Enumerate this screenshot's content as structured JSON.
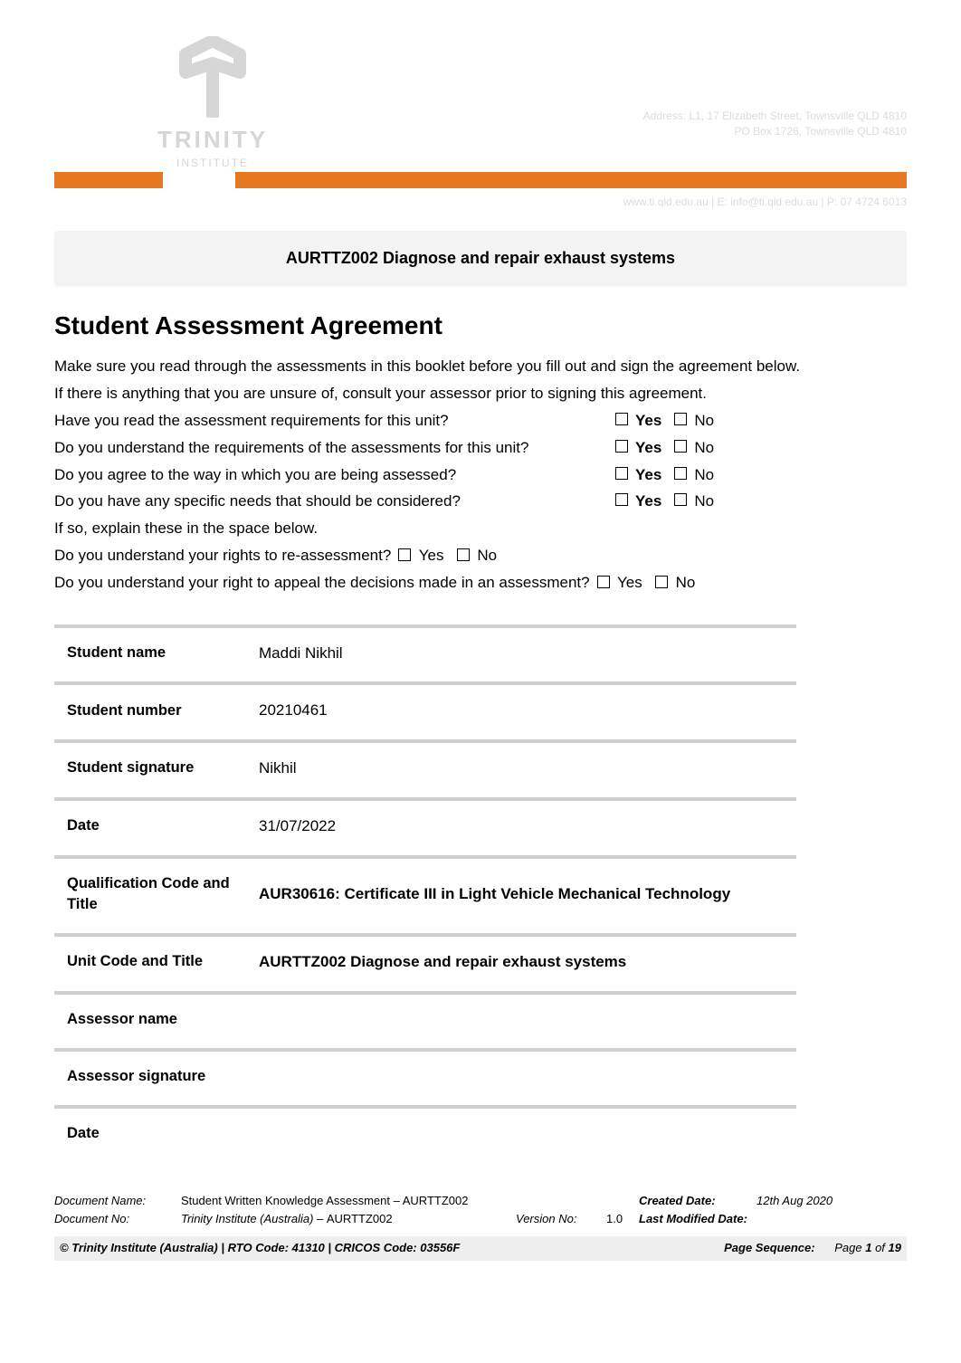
{
  "header": {
    "logo_text": "TRINITY",
    "logo_sub": "INSTITUTE",
    "addr_line1": "Address: L1, 17 Elizabeth Street, Townsville QLD 4810",
    "addr_line2": "PO Box 1726, Townsville QLD 4810",
    "addr_web": "www.ti.qld.edu.au | E: info@ti.qld.edu.au | P: 07 4724 6013"
  },
  "unit_band": "AURTTZ002 Diagnose and repair exhaust systems",
  "section_title": "Student Assessment Agreement",
  "intro_p1": "Make sure you read through the assessments in this booklet before you fill out and sign the agreement below.",
  "intro_p2": "If there is anything that you are unsure of, consult your assessor prior to signing this agreement.",
  "questions": {
    "q1": "Have you read the assessment requirements for this unit?",
    "q2": "Do you understand the requirements of the assessments for this unit?",
    "q3": "Do you agree to the way in which you are being assessed?",
    "q4": "Do you have any specific needs that should be considered?",
    "q5": "If so, explain these in the space below.",
    "q6": "Do you understand your rights to re-assessment?",
    "q7": "Do you understand your right to appeal the decisions made in an assessment?",
    "yes": "Yes",
    "no": "No"
  },
  "table": {
    "rows": [
      {
        "label": "Student name",
        "value": " Maddi Nikhil"
      },
      {
        "label": "Student number",
        "value": "20210461"
      },
      {
        "label": "Student signature",
        "value": "Nikhil"
      },
      {
        "label": "Date",
        "value": "31/07/2022"
      },
      {
        "label": "Qualification Code and Title",
        "value": "AUR30616: Certificate III in Light Vehicle Mechanical Technology",
        "strong": true
      },
      {
        "label": "Unit Code and Title",
        "value": "AURTTZ002 Diagnose and repair exhaust systems",
        "strong": true
      },
      {
        "label": "Assessor name",
        "value": ""
      },
      {
        "label": "Assessor signature",
        "value": ""
      },
      {
        "label": "Date",
        "value": ""
      }
    ]
  },
  "footer": {
    "docname_label": "Document Name:",
    "docname_value": "Student Written Knowledge Assessment – AURTTZ002",
    "created_label": "Created Date:",
    "created_value": "12th Aug 2020",
    "docno_label": "Document No:",
    "docno_value_prefix": "Trinity Institute (Australia) – ",
    "docno_value_code": "AURTTZ002",
    "version_label": "Version No:",
    "version_value": "1.0",
    "lastmod_label": "Last Modified Date:",
    "lastmod_value": "",
    "copyright": "© Trinity Institute (Australia) | RTO Code: 41310 | CRICOS Code: 03556F",
    "pageseq_label": "Page Sequence:",
    "page_prefix": "Page ",
    "page_num": "1",
    "page_of": " of ",
    "page_total": "19"
  }
}
